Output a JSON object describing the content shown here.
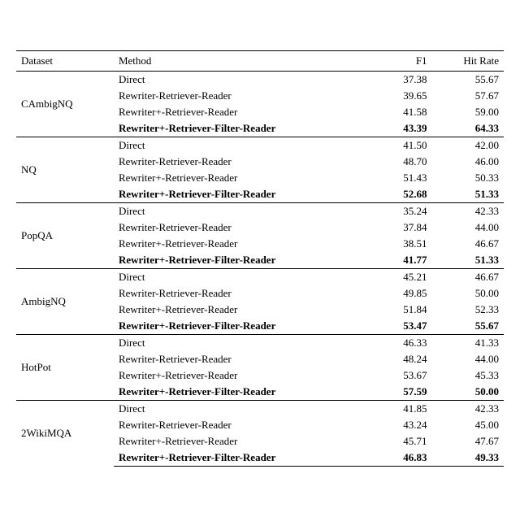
{
  "table": {
    "columns": [
      "Dataset",
      "Method",
      "F1",
      "Hit Rate"
    ],
    "sections": [
      {
        "dataset": "CAmbigNQ",
        "rows": [
          {
            "method": "Direct",
            "f1": "37.38",
            "hitrate": "55.67",
            "bold": false
          },
          {
            "method": "Rewriter-Retriever-Reader",
            "f1": "39.65",
            "hitrate": "57.67",
            "bold": false
          },
          {
            "method": "Rewriter+-Retriever-Reader",
            "f1": "41.58",
            "hitrate": "59.00",
            "bold": false
          },
          {
            "method": "Rewriter+-Retriever-Filter-Reader",
            "f1": "43.39",
            "hitrate": "64.33",
            "bold": true
          }
        ]
      },
      {
        "dataset": "NQ",
        "rows": [
          {
            "method": "Direct",
            "f1": "41.50",
            "hitrate": "42.00",
            "bold": false
          },
          {
            "method": "Rewriter-Retriever-Reader",
            "f1": "48.70",
            "hitrate": "46.00",
            "bold": false
          },
          {
            "method": "Rewriter+-Retriever-Reader",
            "f1": "51.43",
            "hitrate": "50.33",
            "bold": false
          },
          {
            "method": "Rewriter+-Retriever-Filter-Reader",
            "f1": "52.68",
            "hitrate": "51.33",
            "bold": true
          }
        ]
      },
      {
        "dataset": "PopQA",
        "rows": [
          {
            "method": "Direct",
            "f1": "35.24",
            "hitrate": "42.33",
            "bold": false
          },
          {
            "method": "Rewriter-Retriever-Reader",
            "f1": "37.84",
            "hitrate": "44.00",
            "bold": false
          },
          {
            "method": "Rewriter+-Retriever-Reader",
            "f1": "38.51",
            "hitrate": "46.67",
            "bold": false
          },
          {
            "method": "Rewriter+-Retriever-Filter-Reader",
            "f1": "41.77",
            "hitrate": "51.33",
            "bold": true
          }
        ]
      },
      {
        "dataset": "AmbigNQ",
        "rows": [
          {
            "method": "Direct",
            "f1": "45.21",
            "hitrate": "46.67",
            "bold": false
          },
          {
            "method": "Rewriter-Retriever-Reader",
            "f1": "49.85",
            "hitrate": "50.00",
            "bold": false
          },
          {
            "method": "Rewriter+-Retriever-Reader",
            "f1": "51.84",
            "hitrate": "52.33",
            "bold": false
          },
          {
            "method": "Rewriter+-Retriever-Filter-Reader",
            "f1": "53.47",
            "hitrate": "55.67",
            "bold": true
          }
        ]
      },
      {
        "dataset": "HotPot",
        "rows": [
          {
            "method": "Direct",
            "f1": "46.33",
            "hitrate": "41.33",
            "bold": false
          },
          {
            "method": "Rewriter-Retriever-Reader",
            "f1": "48.24",
            "hitrate": "44.00",
            "bold": false
          },
          {
            "method": "Rewriter+-Retriever-Reader",
            "f1": "53.67",
            "hitrate": "45.33",
            "bold": false
          },
          {
            "method": "Rewriter+-Retriever-Filter-Reader",
            "f1": "57.59",
            "hitrate": "50.00",
            "bold": true
          }
        ]
      },
      {
        "dataset": "2WikiMQA",
        "rows": [
          {
            "method": "Direct",
            "f1": "41.85",
            "hitrate": "42.33",
            "bold": false
          },
          {
            "method": "Rewriter-Retriever-Reader",
            "f1": "43.24",
            "hitrate": "45.00",
            "bold": false
          },
          {
            "method": "Rewriter+-Retriever-Reader",
            "f1": "45.71",
            "hitrate": "47.67",
            "bold": false
          },
          {
            "method": "Rewriter+-Retriever-Filter-Reader",
            "f1": "46.83",
            "hitrate": "49.33",
            "bold": true
          }
        ]
      }
    ]
  }
}
